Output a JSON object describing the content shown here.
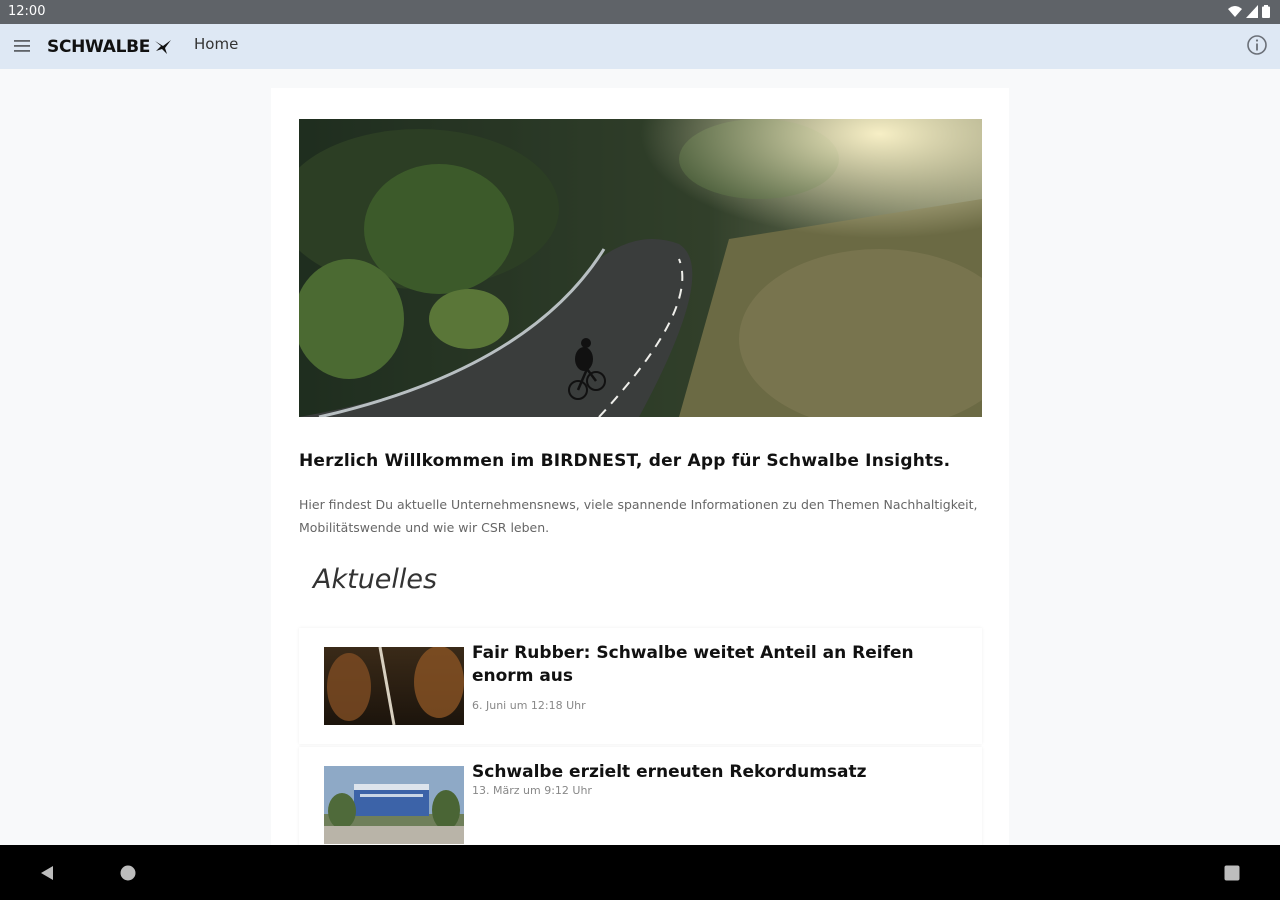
{
  "status_bar": {
    "time": "12:00"
  },
  "app_bar": {
    "brand": "SCHWALBE",
    "page_title": "Home"
  },
  "hero": {
    "alt": "Road cyclist on a winding mountain road"
  },
  "welcome": {
    "title": "Herzlich Willkommen im BIRDNEST, der App für Schwalbe Insights.",
    "intro": "Hier findest Du aktuelle Unternehmensnews, viele spannende Informationen zu den Themen Nachhaltigkeit, Mobilitätswende und wie wir CSR leben."
  },
  "section": {
    "heading": "Aktuelles"
  },
  "news": [
    {
      "title": "Fair Rubber: Schwalbe weitet Anteil an Reifen enorm aus",
      "date": "6. Juni um 12:18 Uhr"
    },
    {
      "title": "Schwalbe erzielt erneuten Rekordumsatz",
      "date": "13. März um 9:12 Uhr"
    }
  ],
  "colors": {
    "app_bar_bg": "#dee8f4",
    "status_bar_bg": "#5f6368",
    "nav_bar_bg": "#000000"
  },
  "icons": [
    "wifi-icon",
    "signal-icon",
    "battery-icon",
    "menu-icon",
    "swallow-icon",
    "info-icon",
    "back-icon",
    "home-icon",
    "recents-icon"
  ]
}
